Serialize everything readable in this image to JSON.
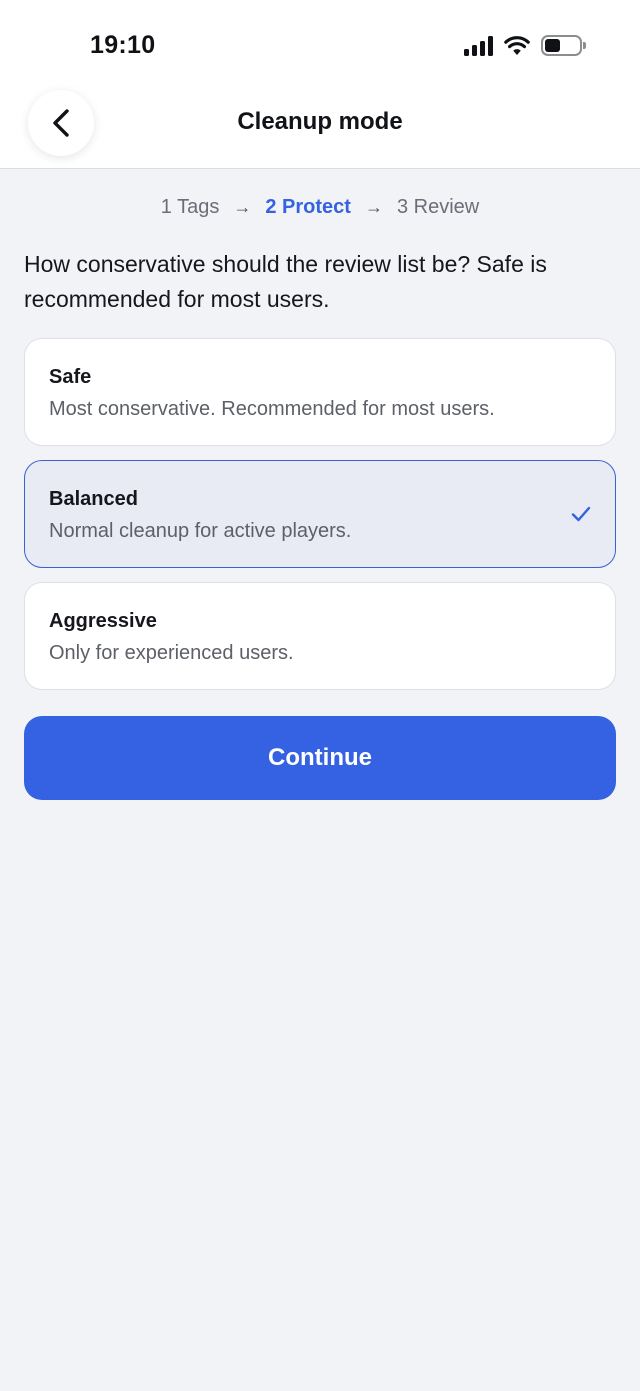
{
  "status_bar": {
    "time": "19:10",
    "icons": [
      "cellular-signal-icon",
      "wifi-icon",
      "battery-icon"
    ]
  },
  "nav": {
    "back_icon": "chevron-left-icon",
    "title": "Cleanup mode"
  },
  "steps": [
    {
      "label": "1 Tags",
      "active": false
    },
    {
      "label": "2 Protect",
      "active": true
    },
    {
      "label": "3 Review",
      "active": false
    }
  ],
  "step_separator": "→",
  "prompt": "How conservative should the review list be? Safe is recommended for most users.",
  "options": [
    {
      "title": "Safe",
      "description": "Most conservative. Recommended for most users.",
      "selected": false
    },
    {
      "title": "Balanced",
      "description": "Normal cleanup for active players.",
      "selected": true
    },
    {
      "title": "Aggressive",
      "description": "Only for experienced users.",
      "selected": false
    }
  ],
  "continue_label": "Continue",
  "colors": {
    "accent": "#3562e3",
    "selected_background": "#e8ebf4",
    "page_background": "#f2f3f7"
  }
}
